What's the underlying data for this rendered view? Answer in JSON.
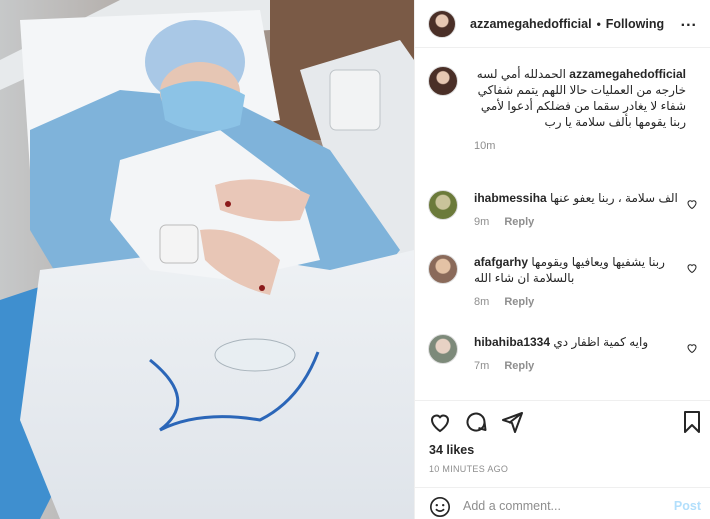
{
  "post": {
    "username": "azzamegahedofficial",
    "separator": "•",
    "follow_status": "Following",
    "more_label": "..."
  },
  "comments": [
    {
      "user": "azzamegahedofficial",
      "text": "الحمدلله أمي لسه خارجه من العمليات حالا اللهم يتمم شفاكي شفاء لا يغادر سقما من فضلكم أدعوا لأمي ربنا يقومها بألف سلامة يا رب",
      "age": "10m",
      "reply": "",
      "avatar_color": "#4a2f27"
    },
    {
      "user": "ihabmessiha",
      "text": "الف سلامة ، ربنا يعفو عنها",
      "age": "9m",
      "reply": "Reply",
      "avatar_color": "#6b7a3a"
    },
    {
      "user": "afafgarhy",
      "text": "ربنا يشفيها ويعافيها ويقومها بالسلامة ان شاء الله",
      "age": "8m",
      "reply": "Reply",
      "avatar_color": "#8a6a5a"
    },
    {
      "user": "hibahiba1334",
      "text": "وايه كمية اظفار دي",
      "age": "7m",
      "reply": "Reply",
      "avatar_color": "#7d8a7a"
    }
  ],
  "actions": {
    "icons": [
      "heart-icon",
      "comment-icon",
      "share-icon",
      "bookmark-icon"
    ],
    "likes": "34 likes",
    "timestamp": "10 MINUTES AGO",
    "add_comment_placeholder": "Add a comment...",
    "post_label": "Post"
  },
  "colors": {
    "text": "#262626",
    "muted": "#8e8e8e",
    "post_disabled": "#b2dffc",
    "border": "#efefef"
  }
}
